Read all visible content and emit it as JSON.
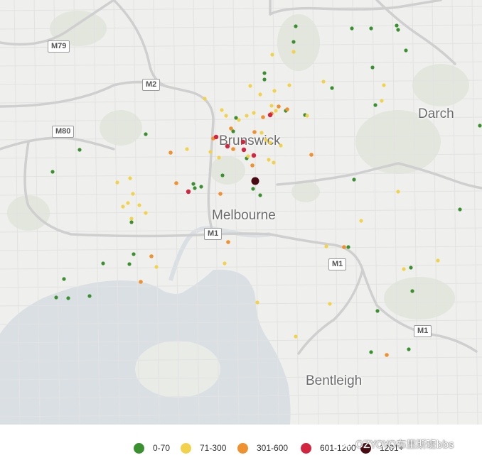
{
  "map": {
    "places": [
      {
        "id": "brunswick",
        "name": "Brunswick"
      },
      {
        "id": "melbourne",
        "name": "Melbourne"
      },
      {
        "id": "darch",
        "name": "Darch"
      },
      {
        "id": "bentleigh",
        "name": "Bentleigh"
      }
    ],
    "routes": [
      {
        "id": "m79",
        "label": "M79"
      },
      {
        "id": "m2",
        "label": "M2"
      },
      {
        "id": "m80",
        "label": "M80"
      },
      {
        "id": "m1-city",
        "label": "M1"
      },
      {
        "id": "m1-east",
        "label": "M1"
      },
      {
        "id": "m1-southeast",
        "label": "M1"
      }
    ],
    "colors": {
      "land": "#eff0ed",
      "water": "#d9dfe3",
      "park": "#e2e6dc",
      "road_major": "#cfcfcf",
      "road_minor": "#e2e2e2"
    },
    "points": [
      {
        "c": 0
      },
      {
        "c": 0
      },
      {
        "c": 0
      },
      {
        "c": 0
      },
      {
        "c": 0
      },
      {
        "c": 0
      },
      {
        "c": 0
      },
      {
        "c": 0
      },
      {
        "c": 0
      },
      {
        "c": 0
      },
      {
        "c": 0
      },
      {
        "c": 0
      },
      {
        "c": 0
      },
      {
        "c": 0
      },
      {
        "c": 0
      },
      {
        "c": 0
      },
      {
        "c": 0
      },
      {
        "c": 0
      },
      {
        "c": 0
      },
      {
        "c": 0
      },
      {
        "c": 0
      },
      {
        "c": 0
      },
      {
        "c": 0
      },
      {
        "c": 0
      },
      {
        "c": 0
      },
      {
        "c": 0
      },
      {
        "c": 0
      },
      {
        "c": 0
      },
      {
        "c": 0
      },
      {
        "c": 0
      },
      {
        "c": 0
      },
      {
        "c": 0
      },
      {
        "c": 0
      },
      {
        "c": 0
      },
      {
        "c": 0
      },
      {
        "c": 0
      },
      {
        "c": 0
      },
      {
        "c": 0
      },
      {
        "c": 0
      },
      {
        "c": 0
      },
      {
        "c": 0
      },
      {
        "c": 0
      },
      {
        "c": 0
      },
      {
        "c": 1
      },
      {
        "c": 1
      },
      {
        "c": 1
      },
      {
        "c": 1
      },
      {
        "c": 1
      },
      {
        "c": 1
      },
      {
        "c": 1
      },
      {
        "c": 1
      },
      {
        "c": 1
      },
      {
        "c": 1
      },
      {
        "c": 1
      },
      {
        "c": 1
      },
      {
        "c": 1
      },
      {
        "c": 1
      },
      {
        "c": 1
      },
      {
        "c": 1
      },
      {
        "c": 1
      },
      {
        "c": 1
      },
      {
        "c": 1
      },
      {
        "c": 1
      },
      {
        "c": 1
      },
      {
        "c": 1
      },
      {
        "c": 1
      },
      {
        "c": 1
      },
      {
        "c": 1
      },
      {
        "c": 1
      },
      {
        "c": 1
      },
      {
        "c": 1
      },
      {
        "c": 1
      },
      {
        "c": 1
      },
      {
        "c": 1
      },
      {
        "c": 1
      },
      {
        "c": 1
      },
      {
        "c": 1
      },
      {
        "c": 1
      },
      {
        "c": 1
      },
      {
        "c": 1
      },
      {
        "c": 1
      },
      {
        "c": 1
      },
      {
        "c": 1
      },
      {
        "c": 1
      },
      {
        "c": 1
      },
      {
        "c": 1
      },
      {
        "c": 1
      },
      {
        "c": 1
      },
      {
        "c": 1
      },
      {
        "c": 2
      },
      {
        "c": 2
      },
      {
        "c": 2
      },
      {
        "c": 2
      },
      {
        "c": 2
      },
      {
        "c": 2
      },
      {
        "c": 2
      },
      {
        "c": 2
      },
      {
        "c": 2
      },
      {
        "c": 2
      },
      {
        "c": 2
      },
      {
        "c": 2
      },
      {
        "c": 2
      },
      {
        "c": 2
      },
      {
        "c": 2
      },
      {
        "c": 2
      },
      {
        "c": 2
      },
      {
        "c": 2
      },
      {
        "c": 3
      },
      {
        "c": 3
      },
      {
        "c": 3
      },
      {
        "c": 3
      },
      {
        "c": 3
      },
      {
        "c": 3
      },
      {
        "c": 3
      },
      {
        "c": 4
      }
    ]
  },
  "legend": {
    "items": [
      {
        "label": "0-70",
        "color": "#3a8f2f"
      },
      {
        "label": "71-300",
        "color": "#f2d24a"
      },
      {
        "label": "301-600",
        "color": "#f0912f"
      },
      {
        "label": "601-1200",
        "color": "#d3253f"
      },
      {
        "label": "1201+",
        "color": "#4a0a12"
      }
    ]
  },
  "watermark": {
    "text": "OZYOYO布里斯班bbs",
    "icon": "wechat-icon"
  }
}
